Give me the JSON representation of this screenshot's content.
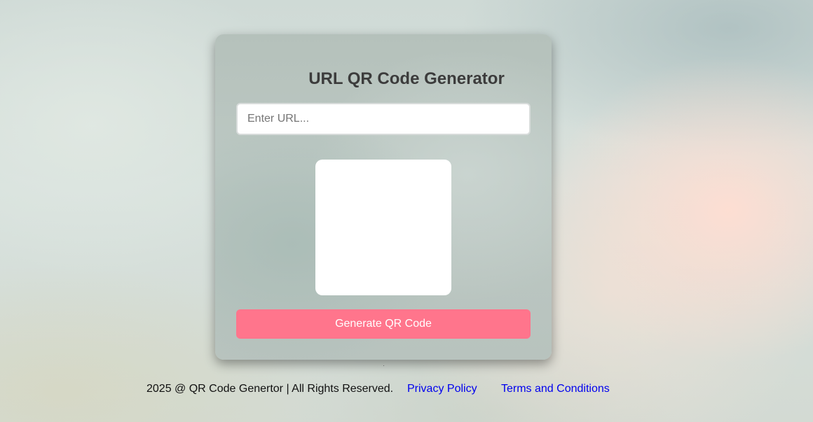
{
  "card": {
    "title": "URL QR Code Generator",
    "url_input": {
      "value": "",
      "placeholder": "Enter URL..."
    },
    "generate_button_label": "Generate QR Code"
  },
  "footer": {
    "copyright": "2025 @ QR Code Genertor | All Rights Reserved.",
    "links": [
      {
        "label": "Privacy Policy"
      },
      {
        "label": "Terms and Conditions"
      }
    ]
  },
  "colors": {
    "button": "#ff758c",
    "link": "#0000ee",
    "title": "#3c3c3c"
  }
}
